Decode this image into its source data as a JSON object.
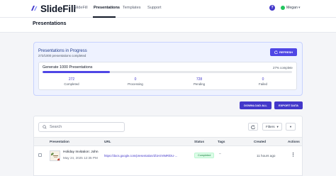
{
  "brand": {
    "name": "SlideFill"
  },
  "nav": {
    "links": [
      {
        "label": "SlideFill"
      },
      {
        "label": "Presentations"
      },
      {
        "label": "Templates"
      },
      {
        "label": "Support"
      }
    ],
    "help_label": "?",
    "user_name": "Megan"
  },
  "page": {
    "title": "Presentations"
  },
  "progress": {
    "title": "Presentations in Progress",
    "subtitle": "272/1000 presentations completed",
    "refresh_label": "REFRESH",
    "job_title": "Generate 1000 Presentations",
    "percent_label": "27% complete",
    "percent": 27,
    "stats": [
      {
        "value": "272",
        "label": "Completed"
      },
      {
        "value": "0",
        "label": "Processing"
      },
      {
        "value": "728",
        "label": "Pending"
      },
      {
        "value": "0",
        "label": "Failed"
      }
    ]
  },
  "actions": {
    "download_all": "DOWNLOAD ALL",
    "export_data": "EXPORT DATA"
  },
  "table": {
    "search_placeholder": "Search",
    "filters_label": "Filters",
    "columns": [
      "Presentation",
      "URL",
      "Status",
      "Tags",
      "Created",
      "Actions"
    ],
    "rows": [
      {
        "title": "Holiday Invitation: John",
        "date": "May 24, 2025 12:35 PM",
        "url": "https://docs.google.com/presentation/d/1HzVtMR/DU-...",
        "status": "Completed",
        "tags": "–",
        "created": "11 hours ago",
        "menu": "⋮"
      }
    ]
  },
  "colors": {
    "accent": "#4f46e5",
    "success": "#15803d",
    "avatar": "#22c55e"
  },
  "icons": [
    "slidefill-logo-icon",
    "help-icon",
    "chevron-down-icon",
    "refresh-icon",
    "search-icon",
    "filter-chevron-icon",
    "more-vertical-icon"
  ]
}
